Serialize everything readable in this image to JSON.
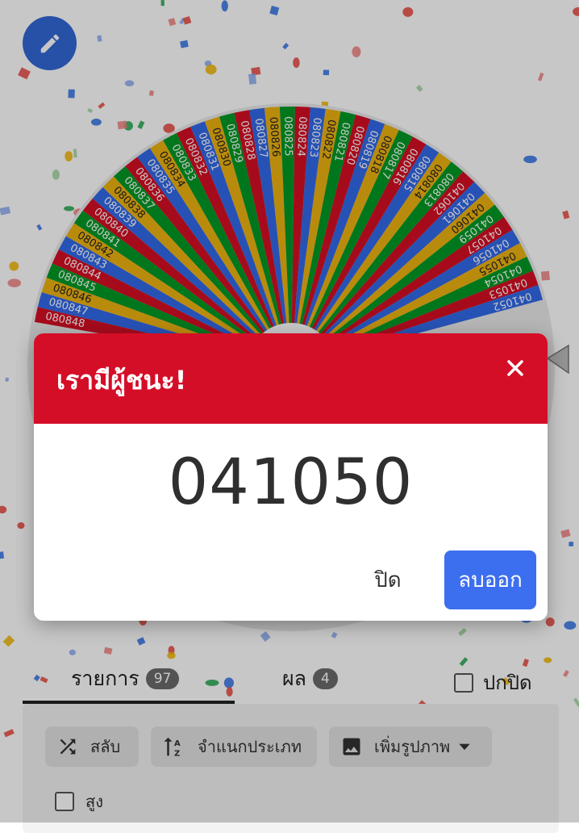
{
  "wheel": {
    "labels": [
      "080848",
      "080847",
      "080846",
      "080845",
      "080844",
      "080843",
      "080842",
      "080841",
      "080840",
      "080839",
      "080838",
      "080837",
      "080836",
      "080835",
      "080834",
      "080833",
      "080832",
      "080831",
      "080830",
      "080829",
      "080828",
      "080827",
      "080826",
      "080825",
      "080824",
      "080823",
      "080822",
      "080821",
      "080820",
      "080819",
      "080818",
      "080817",
      "080816",
      "080815",
      "080814",
      "080813",
      "041062",
      "041061",
      "041060",
      "041059",
      "041057",
      "041056",
      "041055",
      "041054",
      "041053",
      "041052"
    ],
    "colors": [
      "#d50f25",
      "#3369e8",
      "#eeb211",
      "#009925"
    ]
  },
  "edit_icon": "pencil-icon",
  "modal": {
    "title": "เรามีผู้ชนะ!",
    "winner": "041050",
    "close_label": "ปิด",
    "remove_label": "ลบออก",
    "close_icon": "close-icon"
  },
  "tabs": [
    {
      "label": "รายการ",
      "count": "97"
    },
    {
      "label": "ผล",
      "count": "4"
    }
  ],
  "hide_label": "ปกปิด",
  "toolbar": {
    "shuffle_label": "สลับ",
    "sort_label": "จำแนกประเภท",
    "add_image_label": "เพิ่มรูปภาพ",
    "tall_label": "สูง"
  }
}
